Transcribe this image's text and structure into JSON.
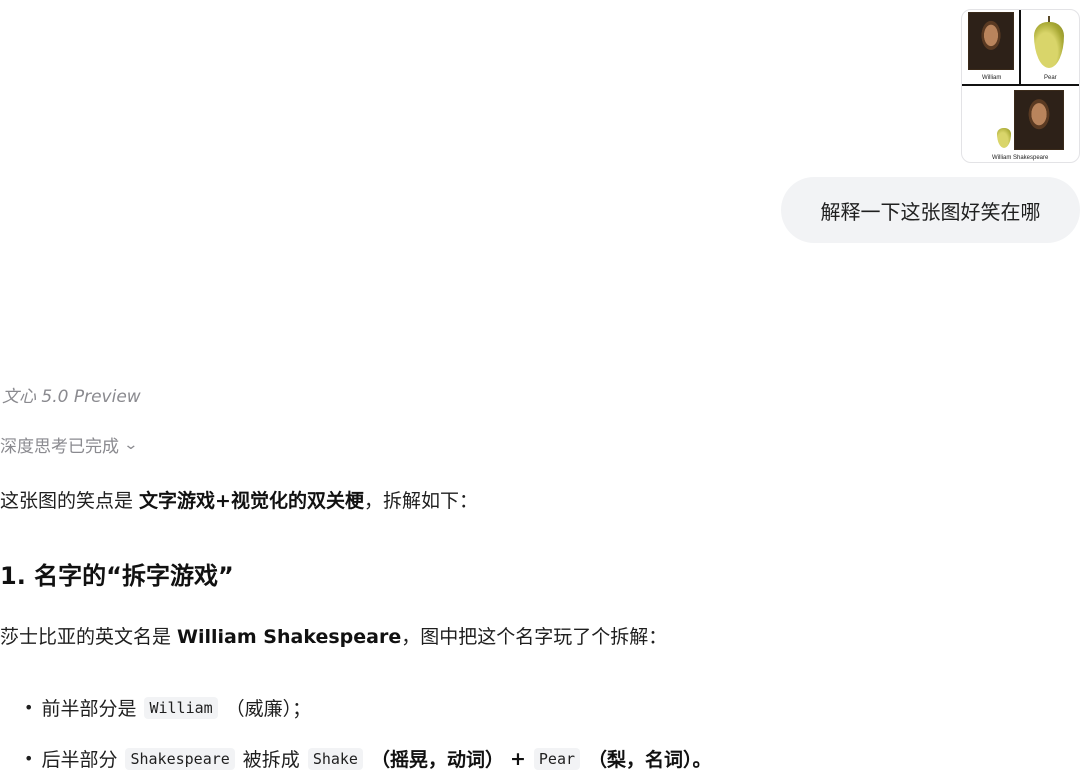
{
  "user": {
    "image": {
      "caption_left": "William",
      "caption_right": "Pear",
      "caption_bottom": "William Shakespeare"
    },
    "message": "解释一下这张图好笑在哪"
  },
  "assistant": {
    "model_name": "文心 5.0 Preview",
    "thinking_status": "深度思考已完成",
    "intro_prefix": "这张图的笑点是 ",
    "intro_bold": "文字游戏+视觉化的双关梗",
    "intro_suffix": "，拆解如下：",
    "heading": "1. 名字的“拆字游戏”",
    "name_prefix": "莎士比亚的英文名是 ",
    "name_bold": "William Shakespeare",
    "name_suffix": "，图中把这个名字玩了个拆解：",
    "bullets": [
      {
        "prefix": "前半部分是",
        "code": "William",
        "suffix": "（威廉）；"
      },
      {
        "prefix": "后半部分",
        "code1": "Shakespeare",
        "mid": "被拆成",
        "code2": "Shake",
        "bold1": "（摇晃，动词）",
        "plus": "+",
        "code3": "Pear",
        "bold2": "（梨，名词）。"
      }
    ]
  }
}
